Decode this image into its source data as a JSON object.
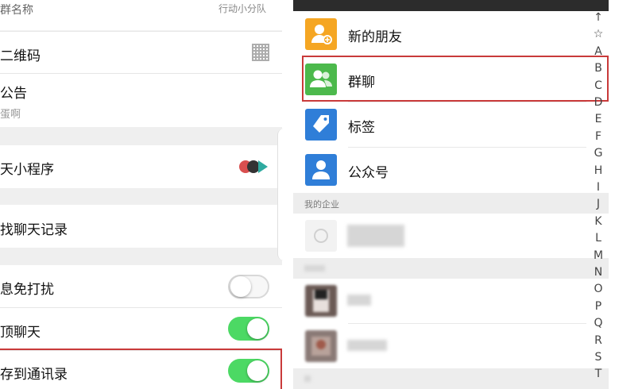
{
  "left": {
    "top_partial_left": "群名称",
    "top_partial_right": "行动小分队",
    "qr_label": "二维码",
    "notice_label": "公告",
    "notice_sub": "蛋啊",
    "miniprogram_label": "天小程序",
    "search_history_label": "找聊天记录",
    "mute_label": "息免打扰",
    "mute_on": false,
    "pin_label": "顶聊天",
    "pin_on": true,
    "save_contacts_label": "存到通讯录",
    "save_contacts_on": true,
    "colors": {
      "toggle_on": "#4cd964",
      "highlight": "#c93a3a"
    }
  },
  "right": {
    "items": [
      {
        "label": "新的朋友",
        "icon": "add-friend-icon",
        "color": "#f5a623"
      },
      {
        "label": "群聊",
        "icon": "group-chat-icon",
        "color": "#4cb94c"
      },
      {
        "label": "标签",
        "icon": "tag-icon",
        "color": "#2f7ed8"
      },
      {
        "label": "公众号",
        "icon": "official-account-icon",
        "color": "#2f7ed8"
      }
    ],
    "section_enterprise": "我的企业",
    "index_letters": [
      "↑",
      "☆",
      "A",
      "B",
      "C",
      "D",
      "E",
      "F",
      "G",
      "H",
      "I",
      "J",
      "K",
      "L",
      "M",
      "N",
      "O",
      "P",
      "Q",
      "R",
      "S",
      "T"
    ]
  }
}
